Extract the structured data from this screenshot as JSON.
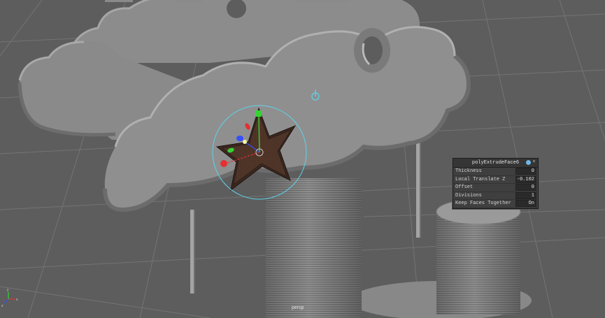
{
  "viewport": {
    "camera_label": "persp",
    "axis_labels": {
      "x": "x",
      "y": "y",
      "z": "z"
    }
  },
  "hud": {
    "title": "polyExtrudeFace6",
    "rows": [
      {
        "label": "Thickness",
        "value": "0"
      },
      {
        "label": "Local Translate Z",
        "value": "-0.102"
      },
      {
        "label": "Offset",
        "value": "0"
      },
      {
        "label": "Divisions",
        "value": "1"
      },
      {
        "label": "Keep Faces Together",
        "value": "On"
      }
    ]
  },
  "colors": {
    "background": "#5d5d5d",
    "grid": "#747474",
    "model": "#8e8e8e",
    "face_selected": "#4b3226",
    "manipulator_ring": "#5fd3ea",
    "axis_x": "#e53030",
    "axis_y": "#35d335",
    "axis_z": "#3450ff"
  }
}
